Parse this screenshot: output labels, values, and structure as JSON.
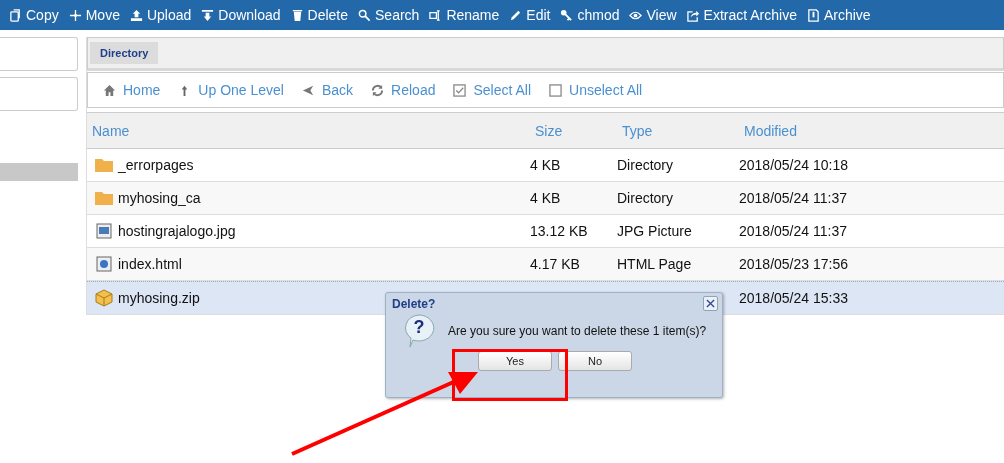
{
  "toolbar": [
    {
      "label": "Copy"
    },
    {
      "label": "Move"
    },
    {
      "label": "Upload"
    },
    {
      "label": "Download"
    },
    {
      "label": "Delete"
    },
    {
      "label": "Search"
    },
    {
      "label": "Rename"
    },
    {
      "label": "Edit"
    },
    {
      "label": "chmod"
    },
    {
      "label": "View"
    },
    {
      "label": "Extract Archive"
    },
    {
      "label": "Archive"
    }
  ],
  "tab": {
    "label": "Directory"
  },
  "nav": [
    {
      "label": "Home"
    },
    {
      "label": "Up One Level"
    },
    {
      "label": "Back"
    },
    {
      "label": "Reload"
    },
    {
      "label": "Select All"
    },
    {
      "label": "Unselect All"
    }
  ],
  "table": {
    "columns": [
      "Name",
      "Size",
      "Type",
      "Modified"
    ],
    "rows": [
      {
        "kind": "folder",
        "name": "_errorpages",
        "size": "4 KB",
        "type": "Directory",
        "modified": "2018/05/24 10:18",
        "selected": false
      },
      {
        "kind": "folder",
        "name": "myhosing_ca",
        "size": "4 KB",
        "type": "Directory",
        "modified": "2018/05/24 11:37",
        "selected": false
      },
      {
        "kind": "image",
        "name": "hostingrajalogo.jpg",
        "size": "13.12 KB",
        "type": "JPG Picture",
        "modified": "2018/05/24 11:37",
        "selected": false
      },
      {
        "kind": "html",
        "name": "index.html",
        "size": "4.17 KB",
        "type": "HTML Page",
        "modified": "2018/05/23 17:56",
        "selected": false
      },
      {
        "kind": "zip",
        "name": "myhosing.zip",
        "modified": "2018/05/24 15:33",
        "selected": true
      }
    ]
  },
  "dialog": {
    "title": "Delete?",
    "icon_text": "?",
    "message": "Are you sure you want to delete these 1 item(s)?",
    "buttons": [
      "Yes",
      "No"
    ]
  }
}
